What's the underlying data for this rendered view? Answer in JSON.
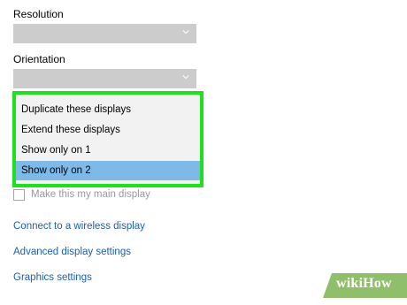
{
  "resolution": {
    "label": "Resolution",
    "value": ""
  },
  "orientation": {
    "label": "Orientation",
    "value": ""
  },
  "display_dropdown": {
    "items": [
      "Duplicate these displays",
      "Extend these displays",
      "Show only on 1",
      "Show only on 2"
    ],
    "selected_index": 3,
    "highlight_color": "#7fb9e8",
    "outline_color": "#1ee01e"
  },
  "main_display_checkbox": {
    "label": "Make this my main display",
    "checked": false
  },
  "links": {
    "wireless": "Connect to a wireless display",
    "advanced": "Advanced display settings",
    "graphics": "Graphics settings"
  },
  "watermark": {
    "prefix": "wiki",
    "suffix": "How",
    "color": "#8fbf6a"
  }
}
